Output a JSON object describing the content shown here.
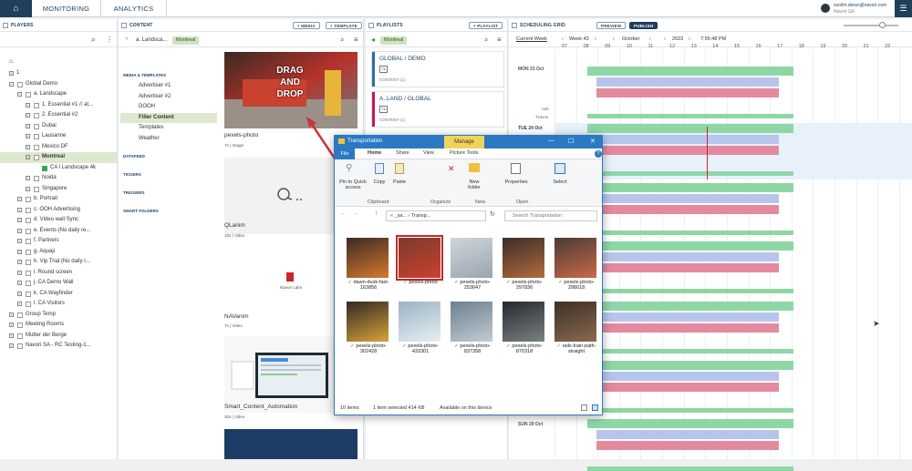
{
  "topbar": {
    "tabs": [
      "MONITORING",
      "ANALYTICS"
    ],
    "user_email": "ssoi/m.doran@navori.com",
    "user_sub": "Navori SA"
  },
  "players": {
    "header": "PLAYERS",
    "tree": [
      {
        "label": "1",
        "level": 0,
        "expander": "⊞"
      },
      {
        "label": "Global Demo",
        "level": 0,
        "expander": "⊟",
        "check": true
      },
      {
        "label": "a. Landscape",
        "level": 1,
        "expander": "⊟",
        "check": true
      },
      {
        "label": "1. Essential #1 // at...",
        "level": 2,
        "expander": "⊞",
        "check": true
      },
      {
        "label": "2. Essential #2",
        "level": 2,
        "expander": "⊞",
        "check": true
      },
      {
        "label": "Dubai",
        "level": 2,
        "expander": "⊞",
        "check": true
      },
      {
        "label": "Lausanne",
        "level": 2,
        "expander": "⊞",
        "check": true
      },
      {
        "label": "Mexico DF",
        "level": 2,
        "expander": "⊞",
        "check": true
      },
      {
        "label": "Montreal",
        "level": 2,
        "expander": "⊟",
        "check": true,
        "selected": true
      },
      {
        "label": "CA l Landscape 4k",
        "level": 3,
        "green": true
      },
      {
        "label": "Noida",
        "level": 2,
        "expander": "⊞",
        "check": true
      },
      {
        "label": "Singapore",
        "level": 2,
        "expander": "⊞",
        "check": true
      },
      {
        "label": "b. Portrait",
        "level": 1,
        "expander": "⊞",
        "check": true
      },
      {
        "label": "c. OOH Advertising",
        "level": 1,
        "expander": "⊞",
        "check": true
      },
      {
        "label": "d. Video wall Sync",
        "level": 1,
        "expander": "⊞",
        "check": true
      },
      {
        "label": "e. Events (No daily re...",
        "level": 1,
        "expander": "⊞",
        "check": true
      },
      {
        "label": "f. Partners",
        "level": 1,
        "expander": "⊞",
        "check": true
      },
      {
        "label": "g. Aquaji",
        "level": 1,
        "expander": "⊞",
        "check": true
      },
      {
        "label": "h. Vip Trial (No daily r...",
        "level": 1,
        "expander": "⊞",
        "check": true
      },
      {
        "label": "i. Round screen",
        "level": 1,
        "expander": "⊞",
        "check": true
      },
      {
        "label": "j. CA Demo Wall",
        "level": 1,
        "expander": "⊞",
        "check": true
      },
      {
        "label": "k. CA Wayfinder",
        "level": 1,
        "expander": "⊞",
        "check": true
      },
      {
        "label": "l. CA Visitors",
        "level": 1,
        "expander": "⊞",
        "check": true
      },
      {
        "label": "Group Temp",
        "level": 0,
        "expander": "⊞",
        "check": true
      },
      {
        "label": "Meeting Rooms",
        "level": 0,
        "expander": "⊞",
        "check": true
      },
      {
        "label": "Mutter der Berge",
        "level": 0,
        "expander": "⊞",
        "check": true
      },
      {
        "label": "Navori SA - RC Testing-1...",
        "level": 0,
        "expander": "⊞",
        "check": true
      }
    ]
  },
  "content": {
    "header": "CONTENT",
    "media_btn": "+ MEDIA",
    "template_btn": "+ TEMPLATE",
    "breadcrumb": "a. Landsca...",
    "filter_chip": "Montreal",
    "categories": [
      {
        "label": "MEDIA & TEMPLATES",
        "head": true
      },
      {
        "label": "Advertiser #1"
      },
      {
        "label": "Advertiser #2"
      },
      {
        "label": "DOOH"
      },
      {
        "label": "Filler Content",
        "selected": true
      },
      {
        "label": "Templates"
      },
      {
        "label": "Weather"
      },
      {
        "label": "DATAFEED",
        "head": true
      },
      {
        "label": "TICKERS",
        "head": true
      },
      {
        "label": "TRIGGERS",
        "head": true
      },
      {
        "label": "SMART FOLDERS",
        "head": true
      }
    ],
    "media": [
      {
        "title": "pexels-photo",
        "meta_a": "7s",
        "meta_b": "Image",
        "kind": "drag"
      },
      {
        "title": "QLanim",
        "meta_a": "10s",
        "meta_b": "Video",
        "kind": "q"
      },
      {
        "title": "NAVanim",
        "meta_a": "7s",
        "meta_b": "Video",
        "kind": "navori"
      },
      {
        "title": "Smart_Content_Automation",
        "meta_a": "32s",
        "meta_b": "Video",
        "kind": "screen"
      }
    ],
    "drag_text": "DRAG AND DROP",
    "navori_logo": "Navori Labs"
  },
  "playlists": {
    "header": "PLAYLISTS",
    "add_btn": "+ PLAYLIST",
    "filter_chip": "Montreal",
    "cards": [
      {
        "title": "GLOBAL / DEMO",
        "badge": "7s",
        "count_label": "CONTENT",
        "count": "1",
        "color": "#2f6f9f"
      },
      {
        "title": "A..LAND / GLOBAL",
        "badge": "7s",
        "count_label": "CONTENT",
        "count": "1",
        "color": "#c2185b"
      }
    ]
  },
  "schedule": {
    "header": "SCHEDULING GRID",
    "preview_btn": "PREVIEW",
    "publish_btn": "PUBLISH",
    "current_week": "Current Week",
    "week": "Week 43",
    "month": "October",
    "year": "2023",
    "time": "7:55:48 PM",
    "hours": [
      "07",
      "08",
      "09",
      "10",
      "11",
      "12",
      "13",
      "14",
      "15",
      "16",
      "17",
      "18",
      "19",
      "20",
      "21",
      "22"
    ],
    "days": [
      "MON 23 Oct",
      "TUE 24 Oct",
      "SUN 29 Oct"
    ],
    "row_labels": [
      "Ads",
      "Tickers"
    ],
    "colors": {
      "green": "#8ed7a5",
      "blue": "#b7c5ec",
      "pink": "#e48a9f",
      "today": "#e8f0fa"
    }
  },
  "explorer": {
    "title": "Transportation",
    "manage_tab": "Manage",
    "ribbon_tabs": [
      "File",
      "Home",
      "Share",
      "View",
      "Picture Tools"
    ],
    "ribbon_buttons": [
      "Pin to Quick access",
      "Copy",
      "Paste",
      "New folder",
      "Properties",
      "Select"
    ],
    "ribbon_groups": [
      "Clipboard",
      "Organize",
      "New",
      "Open"
    ],
    "address_crumbs": "« _sa... › Transp...",
    "search_placeholder": "Search Transportation",
    "files": [
      {
        "name": "dawn-dusk-fast-163856"
      },
      {
        "name": "pexels-photo",
        "selected": true
      },
      {
        "name": "pexels-photo-253647"
      },
      {
        "name": "pexels-photo-297836"
      },
      {
        "name": "pexels-photo-298018"
      },
      {
        "name": "pexels-photo-302428"
      },
      {
        "name": "pexels-photo-433301"
      },
      {
        "name": "pexels-photo-837358"
      },
      {
        "name": "pexels-photo-870318"
      },
      {
        "name": "rails-train-path-straight"
      }
    ],
    "status_count": "10 items",
    "status_selected": "1 item selected  414 KB",
    "status_avail": "Available on this device"
  }
}
